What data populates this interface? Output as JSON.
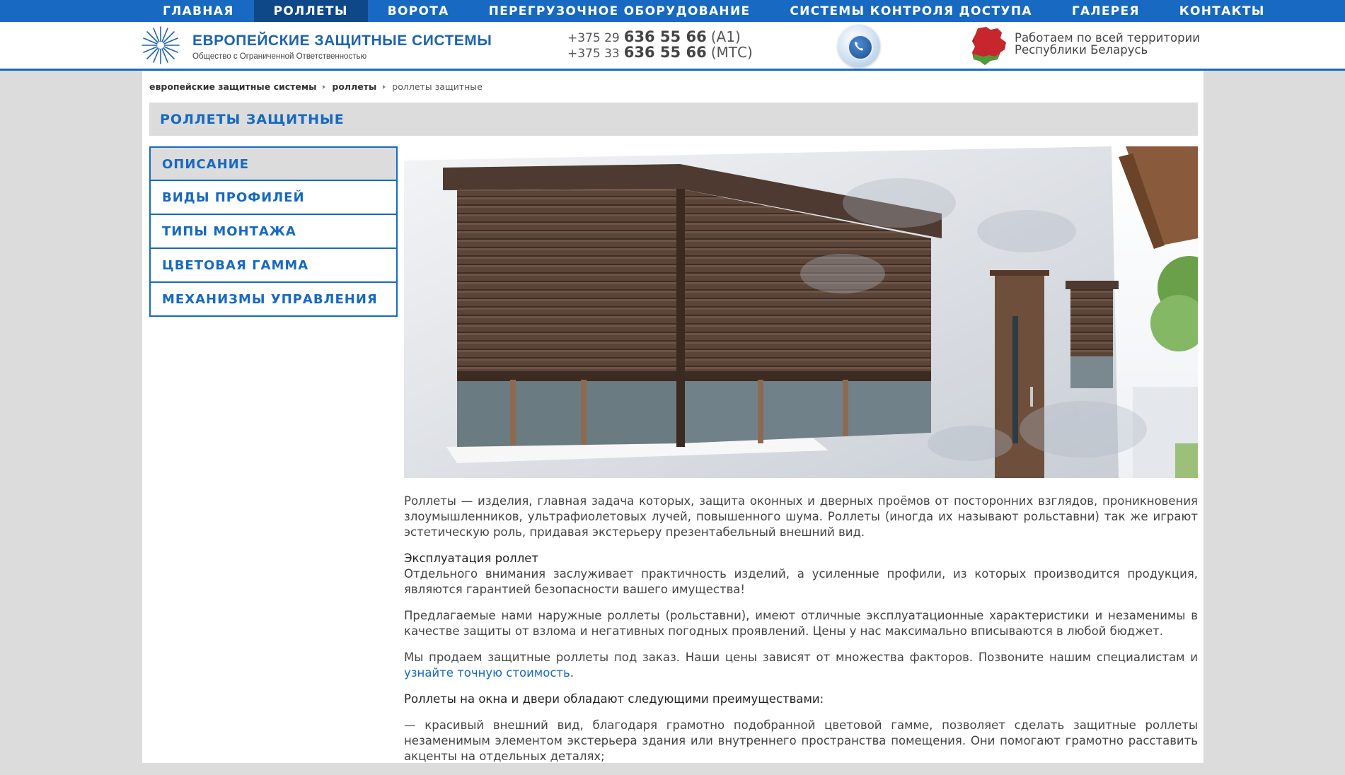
{
  "nav": {
    "items": [
      {
        "label": "ГЛАВНАЯ",
        "active": false
      },
      {
        "label": "РОЛЛЕТЫ",
        "active": true
      },
      {
        "label": "ВОРОТА",
        "active": false
      },
      {
        "label": "ПЕРЕГРУЗОЧНОЕ ОБОРУДОВАНИЕ",
        "active": false
      },
      {
        "label": "СИСТЕМЫ КОНТРОЛЯ ДОСТУПА",
        "active": false
      },
      {
        "label": "ГАЛЕРЕЯ",
        "active": false
      },
      {
        "label": "КОНТАКТЫ",
        "active": false
      }
    ]
  },
  "header": {
    "logo_title": "ЕВРОПЕЙСКИЕ ЗАЩИТНЫЕ СИСТЕМЫ",
    "logo_subtitle": "Общество с Ограниченной Ответственностью",
    "phones": [
      {
        "code": "+375 29",
        "number": "636 55 66",
        "operator": "(A1)"
      },
      {
        "code": "+375 33",
        "number": "636 55 66",
        "operator": "(МТС)"
      }
    ],
    "region_line1": "Работаем по всей территории",
    "region_line2": "Республики Беларусь"
  },
  "breadcrumb": {
    "home": "европейские защитные системы",
    "section": "роллеты",
    "current": "роллеты защитные"
  },
  "page_title": "РОЛЛЕТЫ ЗАЩИТНЫЕ",
  "sidemenu": {
    "items": [
      {
        "label": "ОПИСАНИЕ",
        "active": true
      },
      {
        "label": "ВИДЫ ПРОФИЛЕЙ",
        "active": false
      },
      {
        "label": "ТИПЫ МОНТАЖА",
        "active": false
      },
      {
        "label": "ЦВЕТОВАЯ ГАММА",
        "active": false
      },
      {
        "label": "МЕХАНИЗМЫ УПРАВЛЕНИЯ",
        "active": false
      }
    ]
  },
  "content": {
    "p1": "Роллеты — изделия, главная задача которых, защита оконных и дверных проёмов от посторонних взглядов, проникновения злоумышленников, ультрафиолетовых лучей, повышенного шума. Роллеты (иногда их называют рольставни) так же играют эстетическую роль, придавая экстерьеру презентабельный внешний вид.",
    "h2": "Эксплуатация роллет",
    "p2": "Отдельного внимания заслуживает практичность изделий, а усиленные профили, из которых производится продукция, являются гарантией безопасности вашего имущества!",
    "p3": "Предлагаемые нами наружные роллеты (рольставни), имеют отличные эксплуатационные характеристики и незаменимы в качестве защиты от взлома и негативных погодных проявлений. Цены у нас максимально вписываются в любой бюджет.",
    "p4_text": "Мы продаем защитные роллеты под заказ. Наши цены зависят от множества факторов. Позвоните нашим специалистам и ",
    "p4_link": "узнайте точную стоимость",
    "p4_end": ".",
    "p5": "Роллеты на окна и двери обладают следующими преимуществами:",
    "p6": "— красивый внешний вид, благодаря грамотно подобранной цветовой гамме, позволяет сделать защитные роллеты незаменимым элементом экстерьера здания или внутреннего пространства помещения. Они помогают грамотно расставить акценты на отдельных деталях;"
  },
  "colors": {
    "brand_blue": "#1769c2",
    "nav_active": "#0e4888",
    "panel_gray": "#dcdcdc"
  }
}
